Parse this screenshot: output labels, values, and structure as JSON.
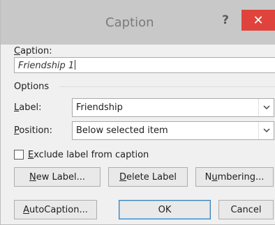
{
  "window": {
    "title": "Caption",
    "help_glyph": "?",
    "close_glyph": "✕"
  },
  "caption": {
    "label_first": "C",
    "label_rest": "aption:",
    "value": "Friendship 1"
  },
  "options": {
    "heading": "Options",
    "label_field": {
      "first": "L",
      "rest": "abel:",
      "value": "Friendship"
    },
    "position_field": {
      "first": "P",
      "rest": "osition:",
      "value": "Below selected item"
    },
    "exclude_checkbox": {
      "first": "E",
      "rest": "xclude label from caption",
      "checked": false
    }
  },
  "buttons": {
    "new_label": {
      "first": "N",
      "rest": "ew Label..."
    },
    "delete_label": {
      "first": "D",
      "rest": "elete Label"
    },
    "numbering": {
      "pre": "N",
      "mid": "u",
      "rest": "mbering..."
    },
    "autocaption": {
      "first": "A",
      "rest": "utoCaption..."
    },
    "ok": "OK",
    "cancel": "Cancel"
  },
  "icons": {
    "dropdown_arrow": "chevron-down-icon",
    "close": "close-icon",
    "help": "help-icon"
  },
  "colors": {
    "titlebar": "#c8c8c8",
    "close_button": "#e0433c",
    "dialog_bg": "#f0f0f0"
  }
}
